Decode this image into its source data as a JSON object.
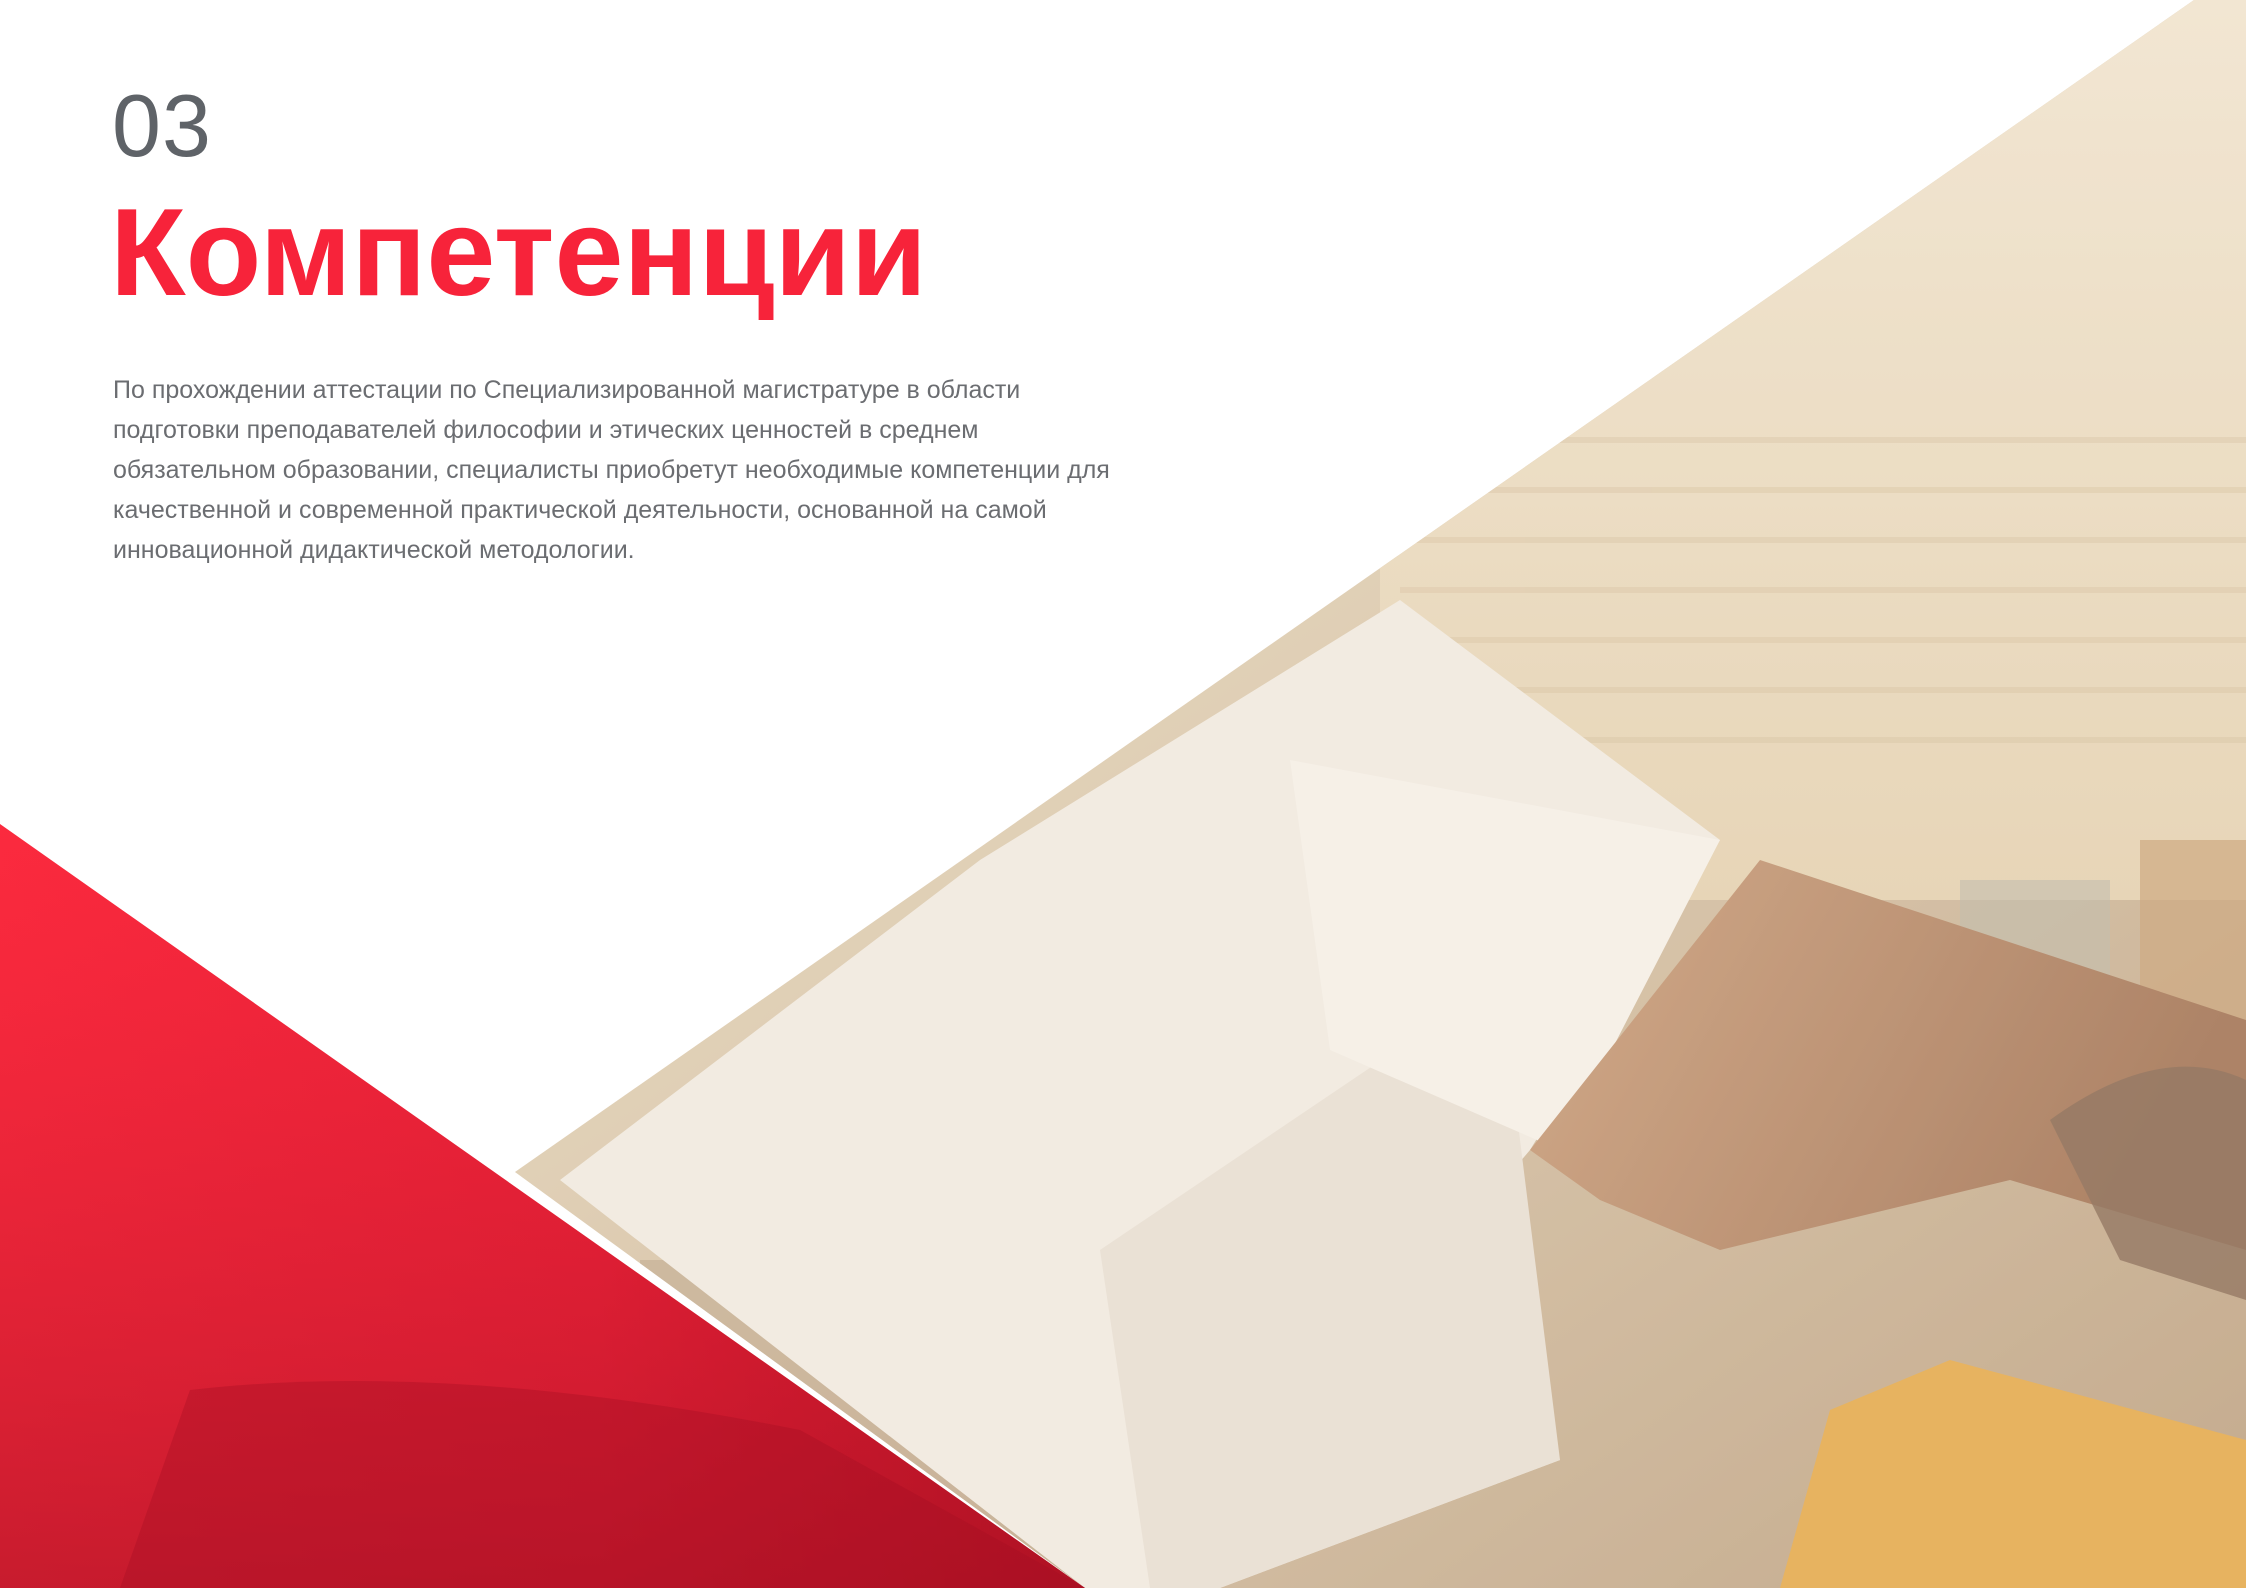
{
  "section": {
    "number": "03",
    "title": "Компетенции",
    "intro": "По прохождении аттестации по Специализированной магистратуре в области подготовки преподавателей философии и этических ценностей в среднем обязательном образовании, специалисты приобретут необходимые компетенции для качественной и современной практической деятельности, основанной на самой инновационной дидактической методологии."
  },
  "colors": {
    "accent": "#f7233a",
    "number": "#5f6368",
    "body_text": "#6b6d71"
  }
}
